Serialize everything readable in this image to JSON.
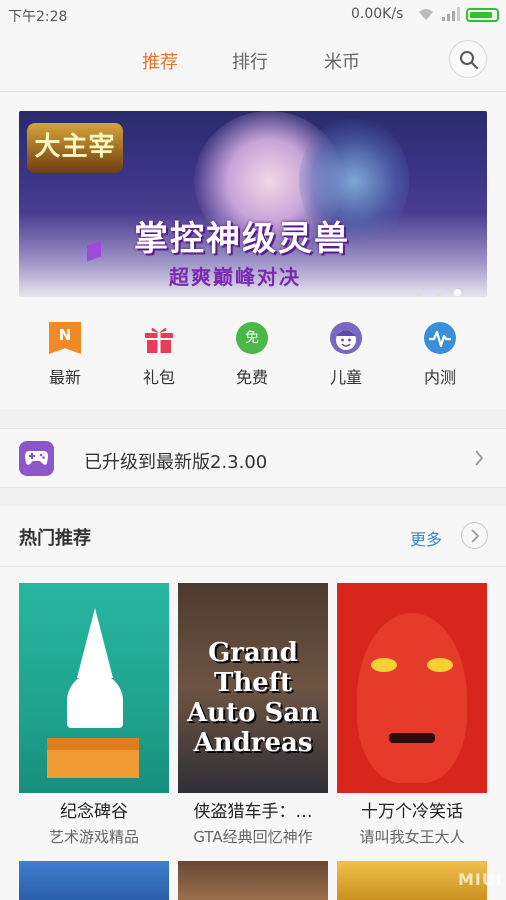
{
  "status_bar": {
    "time": "下午2:28",
    "network_speed": "0.00K/s"
  },
  "header": {
    "tabs": [
      {
        "label": "推荐",
        "active": true
      },
      {
        "label": "排行",
        "active": false
      },
      {
        "label": "米币",
        "active": false
      }
    ],
    "accent_color": "#e8742b"
  },
  "banner": {
    "logo_text": "大主宰",
    "headline": "掌控神级灵兽",
    "subline": "超爽巅峰对决",
    "page_count": 3,
    "active_index": 2
  },
  "categories": [
    {
      "label": "最新",
      "icon": "new-icon",
      "icon_text": "N",
      "color": "#f08a25"
    },
    {
      "label": "礼包",
      "icon": "gift-icon",
      "color": "#e63e56"
    },
    {
      "label": "免费",
      "icon": "free-icon",
      "icon_text": "免",
      "color": "#49b946"
    },
    {
      "label": "儿童",
      "icon": "kid-icon",
      "color": "#7a68c6"
    },
    {
      "label": "内测",
      "icon": "beta-test-icon",
      "color": "#3a90d8"
    }
  ],
  "update_notice": {
    "text": "已升级到最新版2.3.00",
    "icon": "gamepad-icon"
  },
  "recommended": {
    "title": "热门推荐",
    "more_label": "更多",
    "games": [
      {
        "name": "纪念碑谷",
        "desc": "艺术游戏精品"
      },
      {
        "name": "侠盗猎车手：…",
        "desc": "GTA经典回忆神作",
        "art_text": "Grand Theft Auto San Andreas"
      },
      {
        "name": "十万个冷笑话",
        "desc": "请叫我女王大人"
      }
    ]
  },
  "watermark": "MIUI"
}
